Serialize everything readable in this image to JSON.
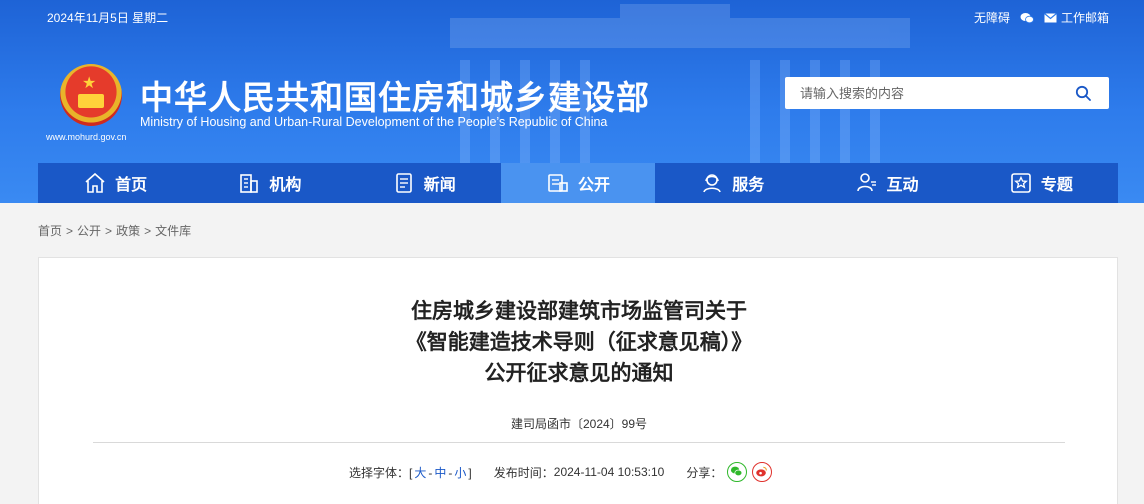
{
  "header": {
    "date": "2024年11月5日 星期二",
    "toplinks": {
      "accessibility": "无障碍",
      "mail": "工作邮箱"
    },
    "title_cn": "中华人民共和国住房和城乡建设部",
    "title_en": "Ministry of Housing and Urban-Rural Development of the People’s Republic of China",
    "site_url": "www.mohurd.gov.cn",
    "search": {
      "placeholder": "请输入搜索的内容",
      "icon": "search-icon"
    }
  },
  "nav": [
    {
      "label": "首页",
      "icon": "home-icon"
    },
    {
      "label": "机构",
      "icon": "building-icon"
    },
    {
      "label": "新闻",
      "icon": "newspaper-icon"
    },
    {
      "label": "公开",
      "icon": "document-icon",
      "active": true
    },
    {
      "label": "服务",
      "icon": "service-icon"
    },
    {
      "label": "互动",
      "icon": "user-interact-icon"
    },
    {
      "label": "专题",
      "icon": "star-icon"
    }
  ],
  "breadcrumb": [
    "首页",
    "公开",
    "政策",
    "文件库"
  ],
  "article": {
    "title_lines": [
      "住房城乡建设部建筑市场监管司关于",
      "《智能建造技术导则（征求意见稿）》",
      "公开征求意见的通知"
    ],
    "doc_no": "建司局函市〔2024〕99号",
    "font_label": "选择字体：",
    "font_open": "[",
    "font_large": "大",
    "font_dash1": "-",
    "font_medium": "中",
    "font_dash2": "-",
    "font_small": "小",
    "font_close": "]",
    "publish_label": "发布时间：",
    "publish_time": "2024-11-04 10:53:10",
    "share_label": "分享："
  },
  "colors": {
    "header_blue": "#2e7cec",
    "nav_blue": "#1a58c7",
    "nav_active": "#4a93f0",
    "wechat": "#2fb82b",
    "weibo": "#e0312c"
  }
}
